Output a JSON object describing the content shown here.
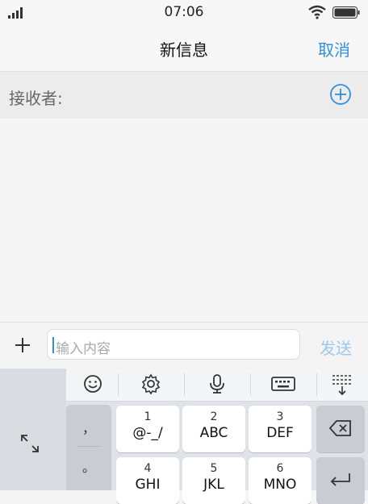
{
  "status_bar": {
    "time": "07:06"
  },
  "nav": {
    "title": "新信息",
    "cancel_label": "取消"
  },
  "recipient": {
    "label": "接收者:"
  },
  "compose": {
    "placeholder": "输入内容",
    "send_label": "发送"
  },
  "keyboard": {
    "punct_row1": "，",
    "punct_row2": "。",
    "keys": [
      {
        "num": "1",
        "letters": "@-_/"
      },
      {
        "num": "2",
        "letters": "ABC"
      },
      {
        "num": "3",
        "letters": "DEF"
      },
      {
        "num": "4",
        "letters": "GHI"
      },
      {
        "num": "5",
        "letters": "JKL"
      },
      {
        "num": "6",
        "letters": "MNO"
      }
    ]
  },
  "colors": {
    "accent": "#2f8fe0",
    "send_disabled": "#9cc8ee"
  }
}
